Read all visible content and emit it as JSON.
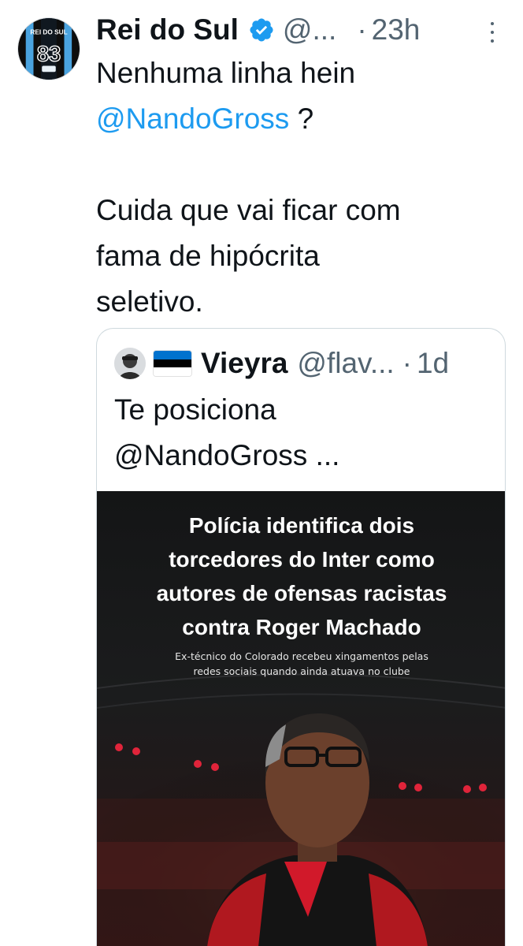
{
  "tweet": {
    "author_name": "Rei do Sul",
    "author_handle": "@...",
    "separator": "·",
    "time": "23h",
    "avatar_text": "REI DO SUL",
    "avatar_number": "83",
    "text_lines": [
      "Nenhuma linha hein",
      "?",
      "",
      "Cuida que vai ficar com",
      "fama de hipócrita",
      "seletivo."
    ],
    "mention": "@NandoGross"
  },
  "quoted_tweet": {
    "author_name": "Vieyra",
    "author_handle": "@flav...",
    "separator": "·",
    "time": "1d",
    "flag_colors": [
      "#0072ce",
      "#000000",
      "#ffffff"
    ],
    "text_line_1": "Te posiciona",
    "mention": "@NandoGross",
    "text_suffix": "...",
    "media": {
      "headline": "Polícia identifica dois\ntorcedores do Inter como\nautores de ofensas racistas\ncontra Roger Machado",
      "subheadline": "Ex-técnico do Colorado recebeu xingamentos pelas\nredes sociais quando ainda atuava no clube"
    }
  },
  "colors": {
    "link": "#1d9bf0",
    "verified": "#1d9bf0",
    "secondary_text": "#536471",
    "border": "#cfd9de"
  },
  "icons": {
    "verified": "verified-badge-icon",
    "more": "more-options-icon"
  }
}
